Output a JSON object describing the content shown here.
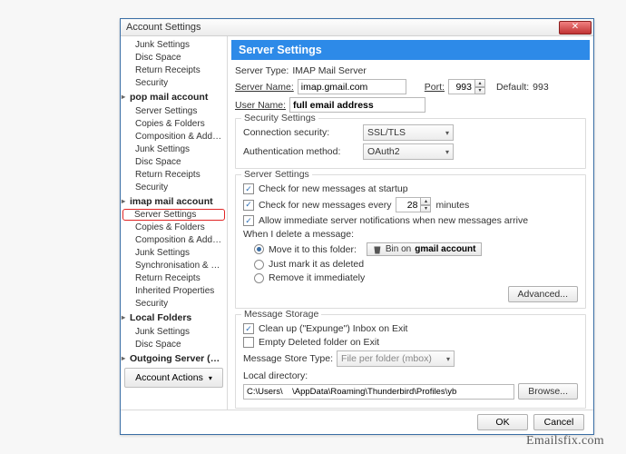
{
  "watermark": "Emailsfix.com",
  "window": {
    "title": "Account Settings",
    "close": "✕"
  },
  "sidebar": {
    "groups": [
      {
        "account": "",
        "items": [
          "Junk Settings",
          "Disc Space",
          "Return Receipts",
          "Security"
        ]
      },
      {
        "account": "pop mail account",
        "items": [
          "Server Settings",
          "Copies & Folders",
          "Composition & Address...",
          "Junk Settings",
          "Disc Space",
          "Return Receipts",
          "Security"
        ]
      },
      {
        "account": "imap mail account",
        "items": [
          "Server Settings",
          "Copies & Folders",
          "Composition & Address...",
          "Junk Settings",
          "Synchronisation & Stora...",
          "Return Receipts",
          "Inherited Properties",
          "Security"
        ],
        "selectedIndex": 0
      },
      {
        "account": "Local Folders",
        "items": [
          "Junk Settings",
          "Disc Space"
        ]
      },
      {
        "account": "Outgoing Server (S...",
        "items": []
      }
    ],
    "actions_label": "Account Actions"
  },
  "panel": {
    "title": "Server Settings",
    "serverType": {
      "label": "Server Type:",
      "value": "IMAP Mail Server"
    },
    "serverName": {
      "label": "Server Name:",
      "value": "imap.gmail.com"
    },
    "port": {
      "label": "Port:",
      "value": "993"
    },
    "default": {
      "label": "Default:",
      "value": "993"
    },
    "userName": {
      "label": "User Name:",
      "value": "full email address"
    },
    "security": {
      "title": "Security Settings",
      "conn": {
        "label": "Connection security:",
        "value": "SSL/TLS"
      },
      "auth": {
        "label": "Authentication method:",
        "value": "OAuth2"
      }
    },
    "server": {
      "title": "Server Settings",
      "chk_startup": {
        "checked": true,
        "label": "Check for new messages at startup"
      },
      "chk_every": {
        "checked": true,
        "label_pre": "Check for new messages every",
        "value": "28",
        "label_post": "minutes"
      },
      "chk_allow": {
        "checked": true,
        "label": "Allow immediate server notifications when new messages arrive"
      },
      "delete_label": "When I delete a message:",
      "r_move": {
        "selected": true,
        "label": "Move it to this folder:",
        "bin_label": "Bin on",
        "bin_acct": "gmail account"
      },
      "r_mark": {
        "selected": false,
        "label": "Just mark it as deleted"
      },
      "r_remove": {
        "selected": false,
        "label": "Remove it immediately"
      },
      "advanced": "Advanced..."
    },
    "storage": {
      "title": "Message Storage",
      "chk_clean": {
        "checked": true,
        "label": "Clean up (\"Expunge\") Inbox on Exit"
      },
      "chk_empty": {
        "checked": false,
        "label": "Empty Deleted folder on Exit"
      },
      "storeType": {
        "label": "Message Store Type:",
        "value": "File per folder (mbox)"
      },
      "localdir": {
        "label": "Local directory:",
        "value": "C:\\Users\\    \\AppData\\Roaming\\Thunderbird\\Profiles\\yb",
        "browse": "Browse..."
      }
    }
  },
  "footer": {
    "ok": "OK",
    "cancel": "Cancel"
  }
}
